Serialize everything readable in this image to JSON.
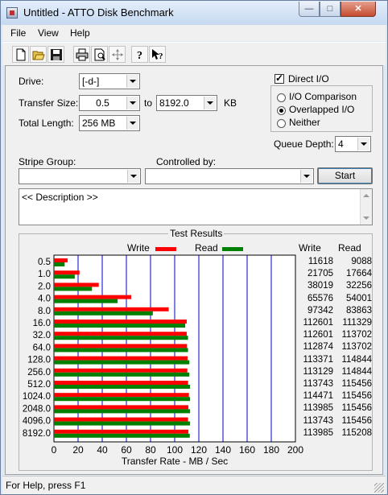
{
  "window": {
    "title": "Untitled - ATTO Disk Benchmark",
    "min_glyph": "—",
    "max_glyph": "□",
    "close_glyph": "✕"
  },
  "menu": [
    "File",
    "View",
    "Help"
  ],
  "toolbar": [
    "new-icon",
    "open-icon",
    "save-icon",
    "print-icon",
    "print-preview-icon",
    "move-icon",
    "help-icon",
    "context-help-icon"
  ],
  "form": {
    "drive_label": "Drive:",
    "drive_value": "[-d-]",
    "transfer_size_label": "Transfer Size:",
    "transfer_from": "0.5",
    "to_label": "to",
    "transfer_to": "8192.0",
    "kb_label": "KB",
    "total_length_label": "Total Length:",
    "total_length_value": "256 MB",
    "direct_io_label": "Direct I/O",
    "direct_io_checked": true,
    "io_options": [
      {
        "label": "I/O Comparison",
        "selected": false
      },
      {
        "label": "Overlapped I/O",
        "selected": true
      },
      {
        "label": "Neither",
        "selected": false
      }
    ],
    "queue_depth_label": "Queue Depth:",
    "queue_depth_value": "4",
    "stripe_group_label": "Stripe Group:",
    "stripe_group_value": "",
    "controlled_by_label": "Controlled by:",
    "controlled_by_value": "",
    "start_button": "Start",
    "description": "<< Description >>"
  },
  "results": {
    "title": "Test Results",
    "write_legend": "Write",
    "read_legend": "Read",
    "write_header": "Write",
    "read_header": "Read",
    "colors": {
      "write": "#ff0000",
      "read": "#008000",
      "grid": "#0000c8"
    }
  },
  "chart_data": {
    "type": "bar",
    "orientation": "horizontal",
    "title": "Test Results",
    "xlabel": "Transfer Rate - MB / Sec",
    "xlim": [
      0,
      200
    ],
    "xticks": [
      0,
      20,
      40,
      60,
      80,
      100,
      120,
      140,
      160,
      180,
      200
    ],
    "categories": [
      "0.5",
      "1.0",
      "2.0",
      "4.0",
      "8.0",
      "16.0",
      "32.0",
      "64.0",
      "128.0",
      "256.0",
      "512.0",
      "1024.0",
      "2048.0",
      "4096.0",
      "8192.0"
    ],
    "series": [
      {
        "name": "Write",
        "values": [
          11618,
          21705,
          38019,
          65576,
          97342,
          112601,
          112601,
          112874,
          113371,
          113129,
          113743,
          114471,
          113985,
          113743,
          113985
        ]
      },
      {
        "name": "Read",
        "values": [
          9088,
          17664,
          32256,
          54001,
          83863,
          111329,
          113702,
          113702,
          114844,
          114844,
          115456,
          115456,
          115456,
          115456,
          115208
        ]
      }
    ],
    "value_units": "KB/s"
  },
  "status": {
    "text": "For Help, press F1"
  }
}
